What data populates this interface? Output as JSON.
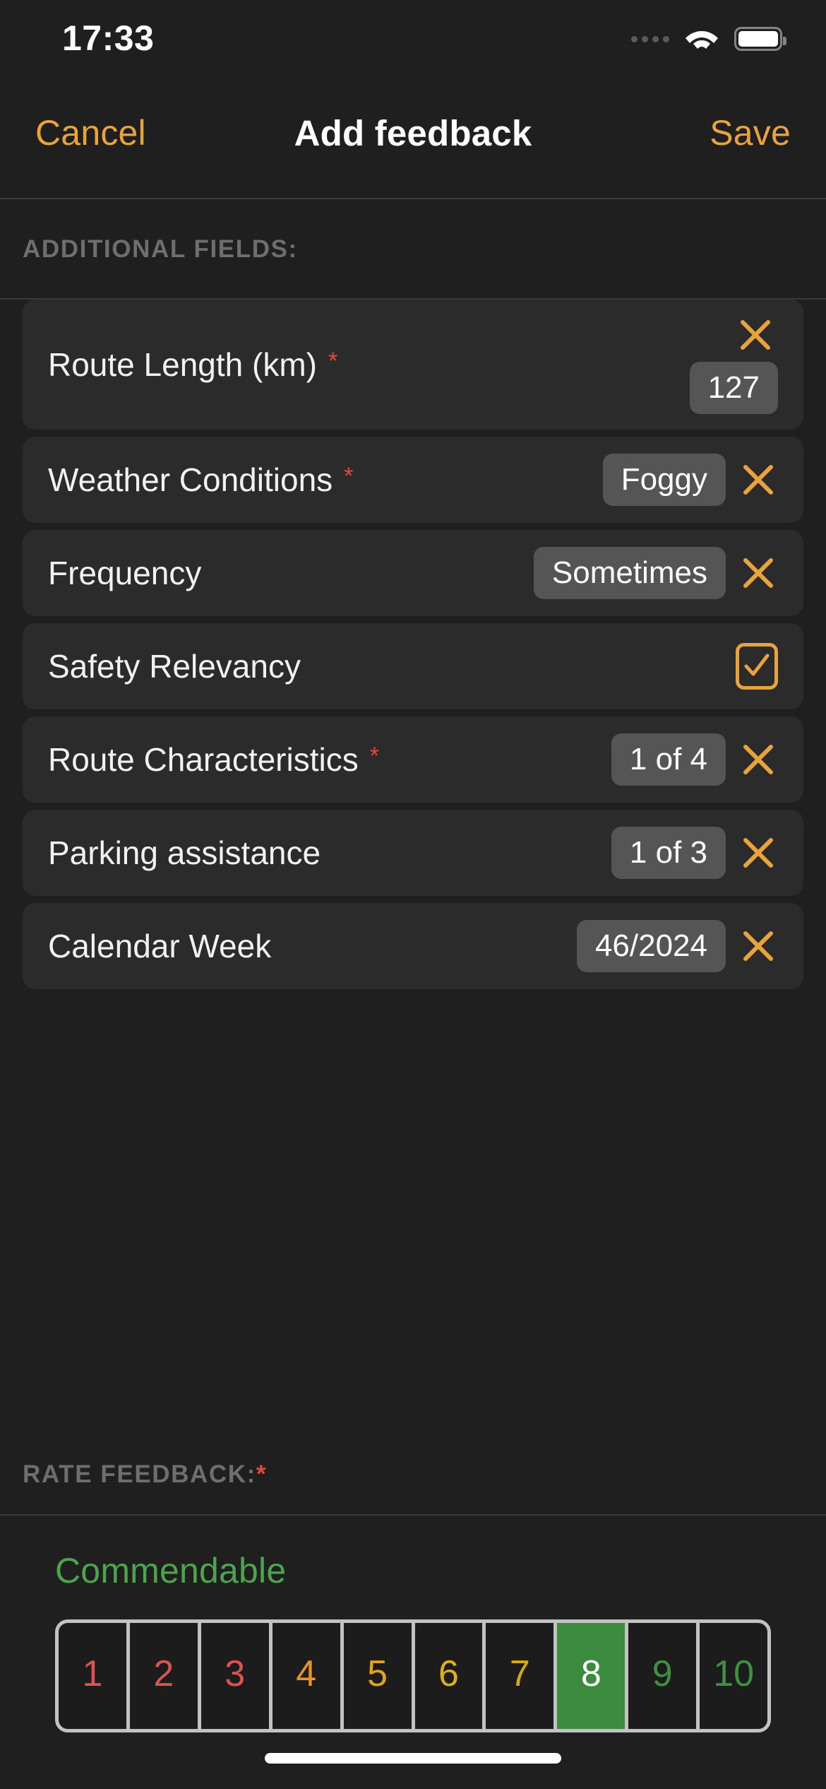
{
  "status_bar": {
    "time": "17:33",
    "signal_icon": "cellular-dots-icon",
    "wifi_icon": "wifi-icon",
    "battery_icon": "battery-full-icon"
  },
  "nav_bar": {
    "cancel_label": "Cancel",
    "title": "Add feedback",
    "save_label": "Save",
    "accent_color": "#e8a33d"
  },
  "sections": {
    "additional_fields_header": "ADDITIONAL FIELDS:",
    "rate_feedback_header": "RATE FEEDBACK:",
    "rate_feedback_required_mark": "*"
  },
  "fields": [
    {
      "label": "Route Length (km)",
      "required": true,
      "required_mark": "*",
      "value": "127",
      "control": "text-value",
      "clear_icon": "close-x-icon",
      "layout": "stacked"
    },
    {
      "label": "Weather Conditions",
      "required": true,
      "required_mark": "*",
      "value": "Foggy",
      "control": "picker-value",
      "clear_icon": "close-x-icon",
      "layout": "inline"
    },
    {
      "label": "Frequency",
      "required": false,
      "required_mark": "",
      "value": "Sometimes",
      "control": "picker-value",
      "clear_icon": "close-x-icon",
      "layout": "inline"
    },
    {
      "label": "Safety Relevancy",
      "required": false,
      "required_mark": "",
      "value": "",
      "control": "checkbox",
      "checked": true,
      "check_icon": "checkmark-icon",
      "layout": "inline"
    },
    {
      "label": "Route Characteristics",
      "required": true,
      "required_mark": "*",
      "value": "1 of 4",
      "control": "multi-select-value",
      "clear_icon": "close-x-icon",
      "layout": "inline"
    },
    {
      "label": "Parking assistance",
      "required": false,
      "required_mark": "",
      "value": "1 of 3",
      "control": "multi-select-value",
      "clear_icon": "close-x-icon",
      "layout": "inline"
    },
    {
      "label": "Calendar Week",
      "required": false,
      "required_mark": "",
      "value": "46/2024",
      "control": "picker-value",
      "clear_icon": "close-x-icon",
      "layout": "inline"
    }
  ],
  "rating": {
    "caption": "Commendable",
    "caption_color": "#4ca44c",
    "selected": 8,
    "ticks": [
      {
        "label": "1",
        "color": "#d9534f"
      },
      {
        "label": "2",
        "color": "#d9534f"
      },
      {
        "label": "3",
        "color": "#d9534f"
      },
      {
        "label": "4",
        "color": "#e8922a"
      },
      {
        "label": "5",
        "color": "#e0a41e"
      },
      {
        "label": "6",
        "color": "#ddb01c"
      },
      {
        "label": "7",
        "color": "#d4aa15"
      },
      {
        "label": "8",
        "color": "#ffffff"
      },
      {
        "label": "9",
        "color": "#3f8f43"
      },
      {
        "label": "10",
        "color": "#3f8f43"
      }
    ],
    "selected_bg": "#3c8c3f"
  },
  "home_indicator": "home-indicator"
}
